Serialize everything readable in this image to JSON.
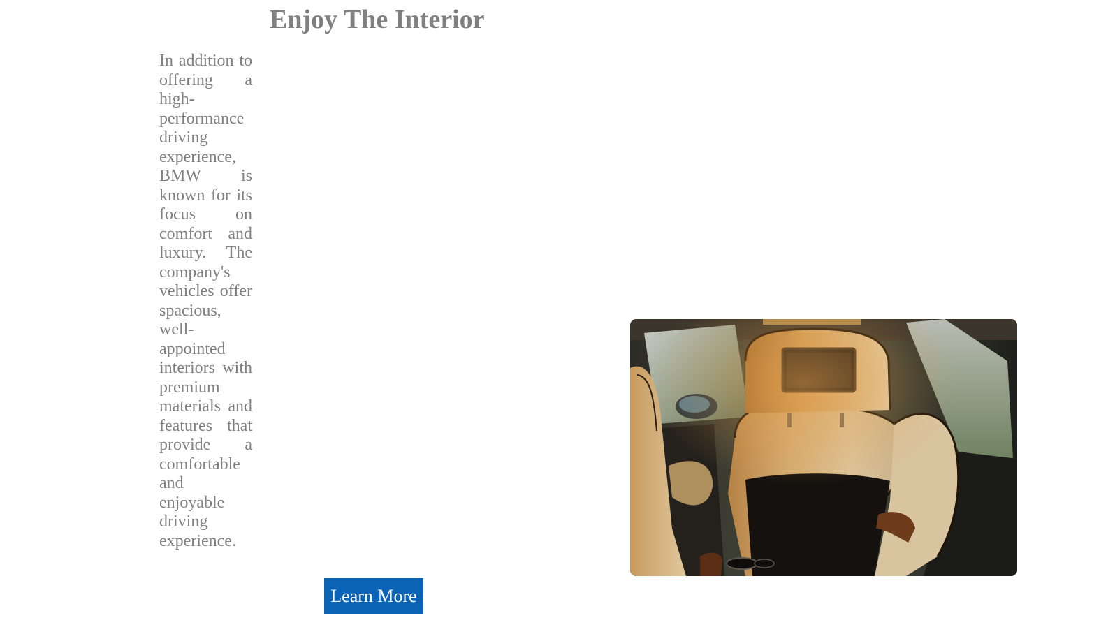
{
  "section": {
    "title": "Enjoy The Interior",
    "description": "In addition to offering a high-performance driving experience, BMW is known for its focus on comfort and luxury. The company's vehicles offer spacious, well-appointed interiors with premium materials and features that provide a comfortable and enjoyable driving experience.",
    "button_label": "Learn More"
  },
  "colors": {
    "text_gray": "#808080",
    "button_blue": "#0b63b6",
    "background": "#ffffff"
  },
  "image": {
    "subject": "car-rear-seat-interior-photo"
  }
}
